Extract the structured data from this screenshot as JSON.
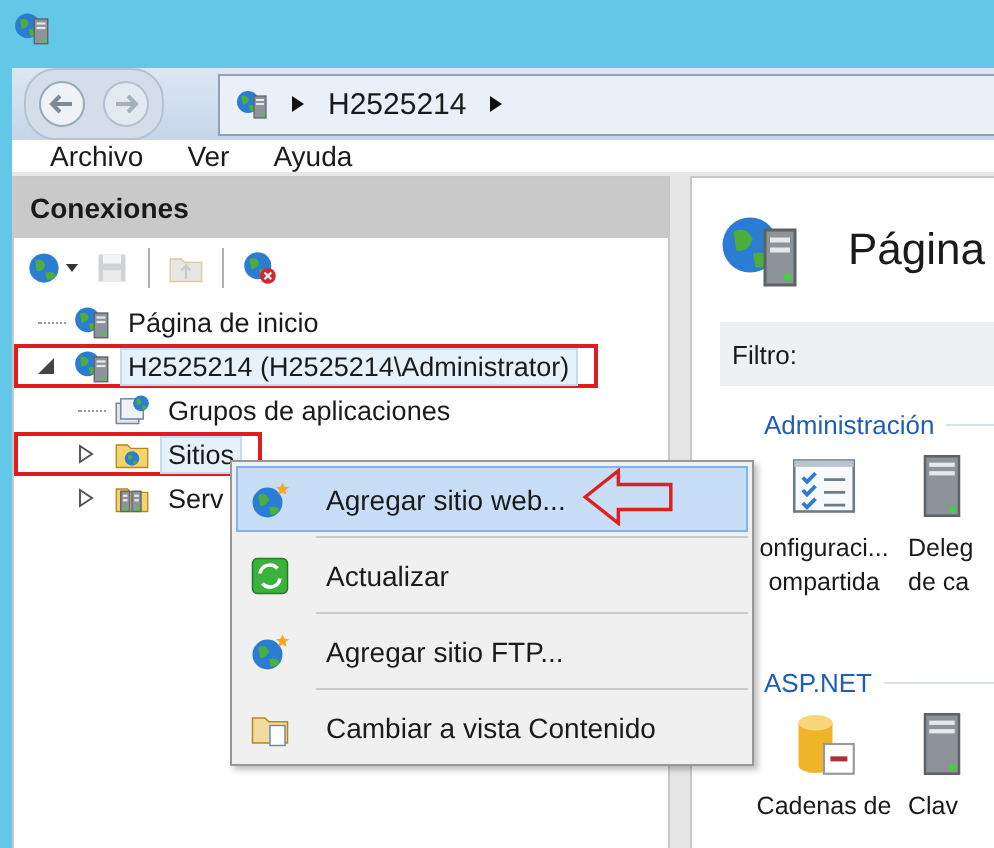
{
  "nav_buttons": [
    {
      "kind": "back",
      "disabled": false
    },
    {
      "kind": "forward",
      "disabled": true
    }
  ],
  "address_bar": {
    "crumbs": [
      "H2525214"
    ]
  },
  "menu": [
    "Archivo",
    "Ver",
    "Ayuda"
  ],
  "connections": {
    "title": "Conexiones",
    "toolbar": [
      {
        "kind": "connect",
        "disabled": false,
        "dropdown": true
      },
      {
        "kind": "save",
        "disabled": true,
        "dropdown": false
      },
      {
        "kind": "separator"
      },
      {
        "kind": "folder-up",
        "disabled": true,
        "dropdown": false
      },
      {
        "kind": "separator"
      },
      {
        "kind": "disconnect",
        "disabled": false,
        "dropdown": false
      }
    ],
    "tree": [
      {
        "label": "Página de inicio",
        "kind": "globe-server",
        "selected": false,
        "annotated": false
      },
      {
        "label": "H2525214 (H2525214\\Administrator)",
        "kind": "globe-server",
        "expanded": true,
        "selected": true,
        "annotated": true,
        "children": [
          {
            "label": "Grupos de aplicaciones",
            "kind": "app-pools",
            "selected": false,
            "annotated": false
          },
          {
            "label": "Sitios",
            "kind": "sites",
            "expanded": false,
            "selected": true,
            "annotated": true
          },
          {
            "label": "Serv",
            "kind": "servers",
            "expanded": false,
            "selected": false,
            "annotated": false
          }
        ]
      }
    ]
  },
  "context_menu": [
    {
      "label": "Agregar sitio web...",
      "kind": "globe-star",
      "selected": true,
      "annotated": true
    },
    {
      "label": "Actualizar",
      "kind": "refresh",
      "selected": false,
      "annotated": false
    },
    {
      "label": "Agregar sitio FTP...",
      "kind": "globe-star",
      "selected": false,
      "annotated": false
    },
    {
      "label": "Cambiar a vista Contenido",
      "kind": "folder-doc",
      "selected": false,
      "annotated": false
    }
  ],
  "home": {
    "title": "Página",
    "filter_label": "Filtro:",
    "groups": [
      {
        "name": "Administración",
        "features": [
          {
            "kind": "checklist",
            "lines": [
              "onfiguraci...",
              "ompartida"
            ]
          },
          {
            "kind": "server",
            "lines": [
              "Deleg",
              "de ca"
            ]
          }
        ]
      },
      {
        "name": "ASP.NET",
        "features": [
          {
            "kind": "database",
            "lines": [
              "Cadenas de"
            ]
          },
          {
            "kind": "server",
            "lines": [
              "Clav"
            ]
          }
        ]
      }
    ]
  }
}
